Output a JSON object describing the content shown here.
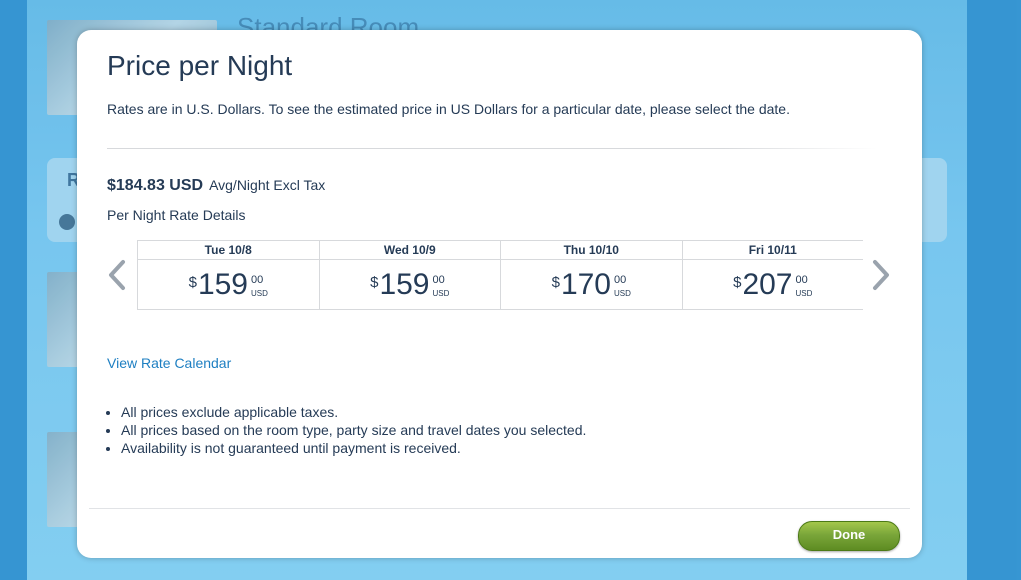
{
  "background": {
    "room_title": "Standard Room",
    "rate_label": "R"
  },
  "modal": {
    "title": "Price per Night",
    "description": "Rates are in U.S. Dollars. To see the estimated price in US Dollars for a particular date, please select the date.",
    "price": {
      "amount": "$184.83 USD",
      "suffix": "Avg/Night Excl Tax"
    },
    "details_label": "Per Night Rate Details",
    "nights": [
      {
        "day": "Tue 10/8",
        "currency_symbol": "$",
        "whole": "159",
        "cents": "00",
        "unit": "USD"
      },
      {
        "day": "Wed 10/9",
        "currency_symbol": "$",
        "whole": "159",
        "cents": "00",
        "unit": "USD"
      },
      {
        "day": "Thu 10/10",
        "currency_symbol": "$",
        "whole": "170",
        "cents": "00",
        "unit": "USD"
      },
      {
        "day": "Fri 10/11",
        "currency_symbol": "$",
        "whole": "207",
        "cents": "00",
        "unit": "USD"
      }
    ],
    "calendar_link": "View Rate Calendar",
    "notes": [
      "All prices exclude applicable taxes.",
      "All prices based on the room type, party size and travel dates you selected.",
      "Availability is not guaranteed until payment is received."
    ],
    "done_label": "Done",
    "prev_icon": "chevron-left-icon",
    "next_icon": "chevron-right-icon"
  },
  "colors": {
    "accent_link": "#1e7fc2",
    "text": "#253b56",
    "done_green": "#7aa63a",
    "backdrop_blue": "#5db7e6"
  }
}
